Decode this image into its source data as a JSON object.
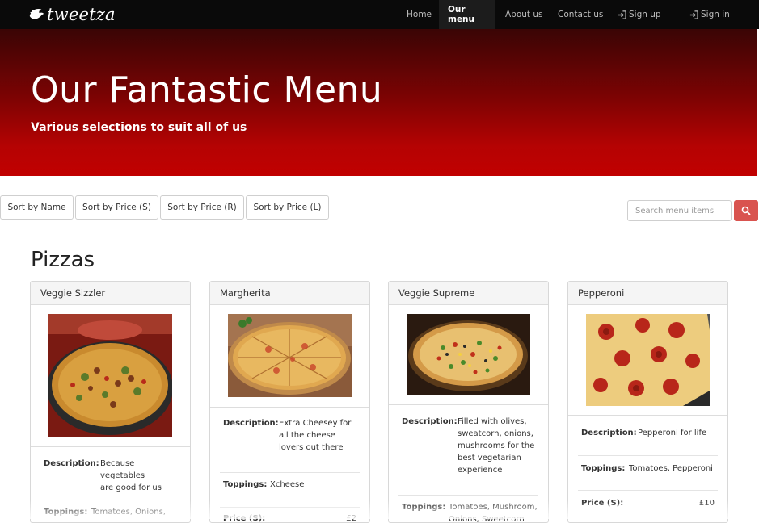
{
  "navbar": {
    "brand": "tweetza",
    "items": [
      {
        "label": "Home"
      },
      {
        "label": "Our menu"
      },
      {
        "label": "About us"
      },
      {
        "label": "Contact us"
      },
      {
        "label": "Sign up",
        "icon": "sign-in-icon"
      },
      {
        "label": "Sign in",
        "icon": "sign-in-icon"
      }
    ],
    "active_item": "Our menu"
  },
  "hero": {
    "title": "Our Fantastic Menu",
    "subtitle": "Various selections to suit all of us"
  },
  "sort": {
    "buttons": [
      "Sort by Name",
      "Sort by Price (S)",
      "Sort by Price (R)",
      "Sort by Price (L)"
    ]
  },
  "search": {
    "placeholder": "Search menu items",
    "button_icon": "search-icon",
    "button_color": "#d9534f"
  },
  "section": {
    "title": "Pizzas"
  },
  "labels": {
    "description": "Description:",
    "toppings": "Toppings:",
    "price_small": "Price (S):"
  },
  "pizzas": [
    {
      "name": "Veggie Sizzler",
      "description": [
        "Because vegetables",
        "are good for us"
      ],
      "toppings": "Tomatoes, Onions,",
      "price_small": ""
    },
    {
      "name": "Margherita",
      "description": [
        "Extra Cheesey for",
        "all the cheese",
        "lovers out there"
      ],
      "toppings": "Xcheese",
      "price_small": "£2"
    },
    {
      "name": "Veggie Supreme",
      "description": [
        "Filled with olives,",
        "sweatcorn, onions,",
        "mushrooms for the",
        "best vegetarian",
        "experience"
      ],
      "toppings": "Tomatoes, Mushroom,",
      "toppings_2": "Onions, Sweetcorn",
      "price_small": ""
    },
    {
      "name": "Pepperoni",
      "description": [
        "Pepperoni for life"
      ],
      "toppings": "Tomatoes, Pepperoni",
      "price_small": "£10"
    }
  ],
  "colors": {
    "navbar_bg": "#0a0a0a",
    "hero_red": "#c10000",
    "hero_dark": "#3a0505"
  }
}
